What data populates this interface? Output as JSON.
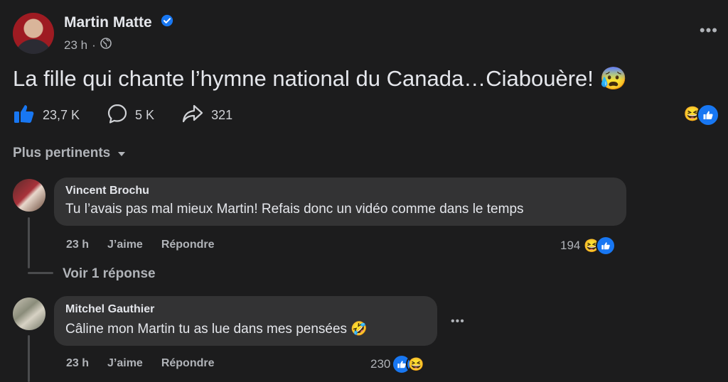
{
  "post": {
    "author": "Martin Matte",
    "time": "23 h",
    "separator": "·",
    "text": "La fille qui chante l’hymne national du Canada…Ciabouère! 😰",
    "more": "•••"
  },
  "actions": {
    "likes": "23,7 K",
    "comments": "5 K",
    "shares": "321"
  },
  "sort": {
    "label": "Plus pertinents"
  },
  "comments": [
    {
      "name": "Vincent Brochu",
      "text": "Tu l’avais pas mal mieux Martin! Refais donc un vidéo comme dans le temps",
      "time": "23 h",
      "like": "J’aime",
      "reply": "Répondre",
      "count": "194",
      "reply_link": "Voir 1 réponse"
    },
    {
      "name": "Mitchel Gauthier",
      "text": "Câline mon Martin tu as lue dans mes pensées 🤣",
      "time": "23 h",
      "like": "J’aime",
      "reply": "Répondre",
      "count": "230",
      "more": "•••"
    }
  ],
  "icons": {
    "like": "thumbs-up-icon",
    "comment": "speech-bubble-icon",
    "share": "share-arrow-icon",
    "verified": "verified-badge-icon",
    "privacy": "globe-icon",
    "sort": "caret-down-icon"
  },
  "colors": {
    "accent": "#1877f2",
    "background": "#1c1c1d",
    "bubble": "#333334"
  }
}
